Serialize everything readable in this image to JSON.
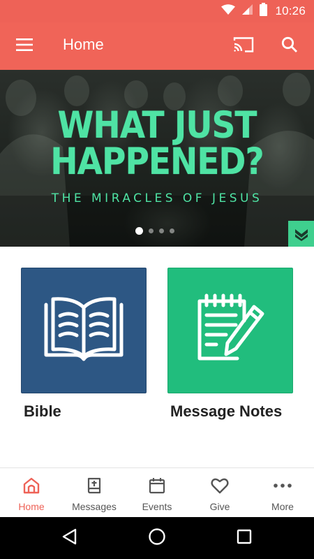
{
  "status_bar": {
    "time": "10:26",
    "icons": [
      "wifi-icon",
      "signal-icon",
      "battery-icon"
    ]
  },
  "app_bar": {
    "title": "Home",
    "icons": [
      "menu-icon",
      "cast-icon",
      "search-icon"
    ]
  },
  "banner": {
    "title_line1": "WHAT JUST",
    "title_line2": "HAPPENED?",
    "subtitle": "THE MIRACLES OF JESUS",
    "page_count": 4,
    "active_page": 1,
    "badge_icon": "chevron-down-badge-icon"
  },
  "tiles": [
    {
      "label": "Bible",
      "icon": "open-book-icon",
      "color": "#2d5784"
    },
    {
      "label": "Message Notes",
      "icon": "notepad-pencil-icon",
      "color": "#21bd7d"
    }
  ],
  "bottom_nav": {
    "active": "Home",
    "items": [
      {
        "label": "Home",
        "icon": "home-icon"
      },
      {
        "label": "Messages",
        "icon": "bible-cross-icon"
      },
      {
        "label": "Events",
        "icon": "calendar-icon"
      },
      {
        "label": "Give",
        "icon": "heart-icon"
      },
      {
        "label": "More",
        "icon": "more-dots-icon"
      }
    ]
  },
  "system_nav": [
    "back-icon",
    "home-circle-icon",
    "recents-icon"
  ],
  "colors": {
    "primary": "#f06458",
    "status_bar": "#ee6257",
    "bible_tile": "#2d5784",
    "notes_tile": "#21bd7d",
    "banner_accent": "#4fe3a4"
  }
}
